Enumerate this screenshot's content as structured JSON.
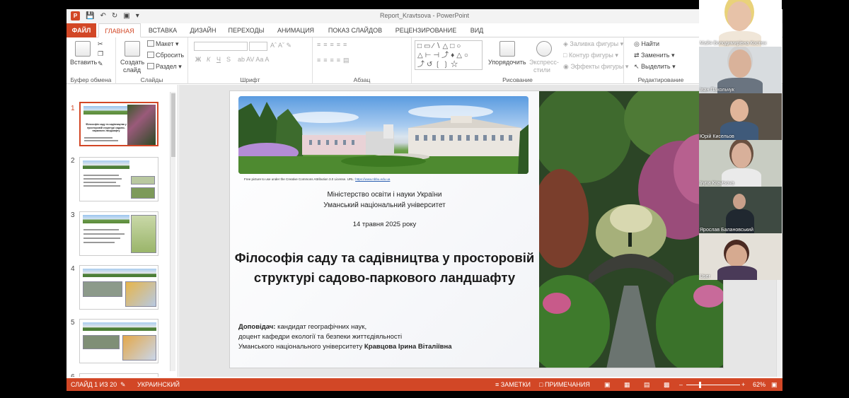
{
  "window": {
    "title": "Report_Kravtsova - PowerPoint",
    "app_icon": "P"
  },
  "tabs": [
    "ФАЙЛ",
    "ГЛАВНАЯ",
    "ВСТАВКА",
    "ДИЗАЙН",
    "ПЕРЕХОДЫ",
    "АНИМАЦИЯ",
    "ПОКАЗ СЛАЙДОВ",
    "РЕЦЕНЗИРОВАНИЕ",
    "ВИД"
  ],
  "ribbon": {
    "clipboard": {
      "paste": "Вставить",
      "label": "Буфер обмена"
    },
    "slides": {
      "new_slide_1": "Создать",
      "new_slide_2": "слайд",
      "layout": "Макет",
      "reset": "Сбросить",
      "section": "Раздел",
      "label": "Слайды"
    },
    "font": {
      "bold": "Ж",
      "italic": "К",
      "underline": "Ч",
      "strike": "S",
      "label": "Шрифт"
    },
    "paragraph": {
      "label": "Абзац"
    },
    "drawing": {
      "arrange": "Упорядочить",
      "quick_styles_1": "Экспресс-",
      "quick_styles_2": "стили",
      "shape_fill": "Заливка фигуры",
      "shape_outline": "Контур фигуры",
      "shape_effects": "Эффекты фигуры",
      "label": "Рисование"
    },
    "editing": {
      "find": "Найти",
      "replace": "Заменить",
      "select": "Выделить",
      "label": "Редактирование"
    }
  },
  "thumbnails": [
    {
      "num": "1",
      "text": "Філософія саду та садівництва у просторовій структурі садово-паркового ландшафту"
    },
    {
      "num": "2",
      "text": ""
    },
    {
      "num": "3",
      "text": ""
    },
    {
      "num": "4",
      "text": ""
    },
    {
      "num": "5",
      "text": ""
    },
    {
      "num": "6",
      "text": ""
    }
  ],
  "slide": {
    "credit": "Free picture to use under the Creative Commons Attribution 3.0 License. URL:",
    "credit_link": "https://www.nbbu.edu.ua",
    "ministry": "Міністерство освіти і науки України",
    "university": "Уманський національний університет",
    "date": "14 травня 2025 року",
    "title_line1": "Філософія саду та садівництва у просторовій",
    "title_line2": "структурі садово-паркового ландшафту",
    "speaker_label": "Доповідач:",
    "speaker_line1": " кандидат географічних наук,",
    "speaker_line2": "доцент кафедри екології та безпеки життєдіяльності",
    "speaker_line3": "Уманського національного університету ",
    "speaker_name": "Кравцова Ірина Віталіївна"
  },
  "status": {
    "slide_counter": "СЛАЙД 1 ИЗ 20",
    "language": "УКРАИНСКИЙ",
    "notes": "ЗАМЕТКИ",
    "comments": "ПРИМЕЧАНИЯ",
    "zoom": "62%"
  },
  "participants": [
    {
      "name": "Майя Володимирівна Костюк"
    },
    {
      "name": "Іван Пахольчук"
    },
    {
      "name": "Юрій Кисельов"
    },
    {
      "name": "Iryna Kravtsova"
    },
    {
      "name": "Ярослав Балановський"
    },
    {
      "name": "User"
    }
  ],
  "colors": {
    "accent": "#d24726",
    "ribbon_bg": "#ffffff",
    "slide_area_bg": "#e6e6e6"
  }
}
